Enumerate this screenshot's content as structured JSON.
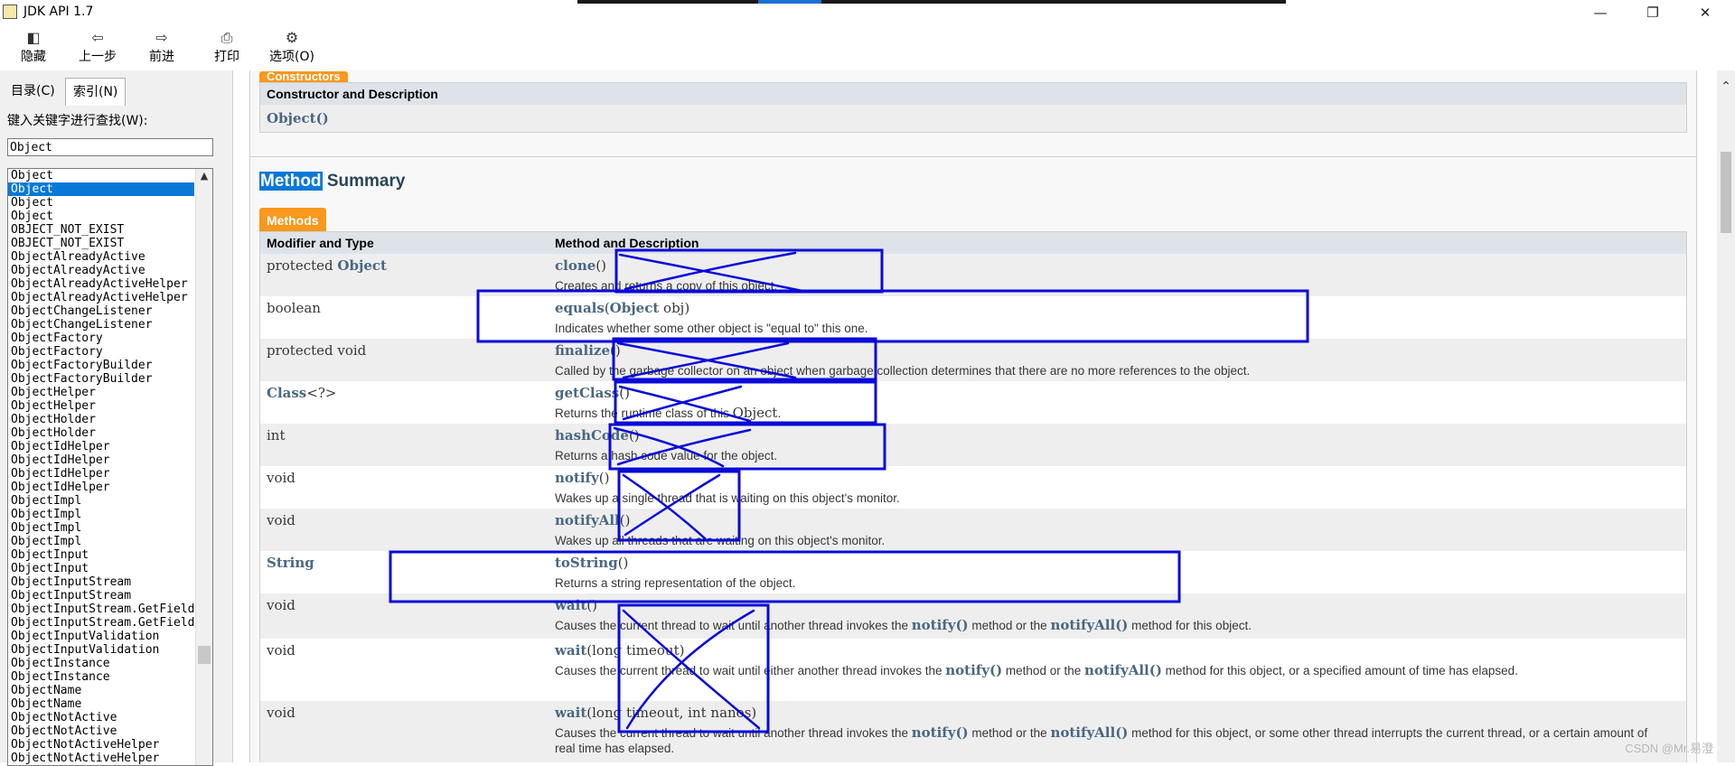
{
  "window": {
    "title": "JDK API 1.7",
    "min": "—",
    "max": "❐",
    "close": "✕"
  },
  "toolbar": [
    {
      "label": "隐藏",
      "icon": "hide-icon",
      "glyph": "◧"
    },
    {
      "label": "上一步",
      "icon": "back-arrow-icon",
      "glyph": "⇦"
    },
    {
      "label": "前进",
      "icon": "forward-arrow-icon",
      "glyph": "⇨"
    },
    {
      "label": "打印",
      "icon": "printer-icon",
      "glyph": "⎙"
    },
    {
      "label": "选项(O)",
      "icon": "options-icon",
      "glyph": "⚙"
    }
  ],
  "sidebar": {
    "tabs": [
      {
        "label": "目录(C)"
      },
      {
        "label": "索引(N)"
      }
    ],
    "search_label": "键入关键字进行查找(W):",
    "search_value": "Object",
    "selected_index": 1,
    "items": [
      "Object",
      "Object",
      "Object",
      "Object",
      "OBJECT_NOT_EXIST",
      "OBJECT_NOT_EXIST",
      "ObjectAlreadyActive",
      "ObjectAlreadyActive",
      "ObjectAlreadyActiveHelper",
      "ObjectAlreadyActiveHelper",
      "ObjectChangeListener",
      "ObjectChangeListener",
      "ObjectFactory",
      "ObjectFactory",
      "ObjectFactoryBuilder",
      "ObjectFactoryBuilder",
      "ObjectHelper",
      "ObjectHelper",
      "ObjectHolder",
      "ObjectHolder",
      "ObjectIdHelper",
      "ObjectIdHelper",
      "ObjectIdHelper",
      "ObjectIdHelper",
      "ObjectImpl",
      "ObjectImpl",
      "ObjectImpl",
      "ObjectImpl",
      "ObjectInput",
      "ObjectInput",
      "ObjectInputStream",
      "ObjectInputStream",
      "ObjectInputStream.GetField",
      "ObjectInputStream.GetField",
      "ObjectInputValidation",
      "ObjectInputValidation",
      "ObjectInstance",
      "ObjectInstance",
      "ObjectName",
      "ObjectName",
      "ObjectNotActive",
      "ObjectNotActive",
      "ObjectNotActiveHelper",
      "ObjectNotActiveHelper"
    ]
  },
  "constructors": {
    "caption": "Constructors",
    "header": "Constructor and Description",
    "row": "Object()"
  },
  "method_summary": {
    "title_hl": "Method",
    "title_rest": " Summary",
    "caption": "Methods",
    "col_type": "Modifier and Type",
    "col_desc": "Method and Description",
    "rows": [
      {
        "type_pre": "protected ",
        "type_link": "Object",
        "name": "clone",
        "params": "()",
        "desc": "Creates and returns a copy of this object."
      },
      {
        "type_pre": "boolean",
        "type_link": "",
        "name": "equals",
        "params_link": "Object",
        "params": " obj)",
        "params_open": "(",
        "desc": "Indicates whether some other object is \"equal to\" this one."
      },
      {
        "type_pre": "protected void",
        "type_link": "",
        "name": "finalize",
        "params": "()",
        "desc": "Called by the garbage collector on an object when garbage collection determines that there are no more references to the object."
      },
      {
        "type_pre": "",
        "type_link": "Class",
        "type_post": "<?>",
        "name": "getClass",
        "params": "()",
        "desc": "Returns the runtime class of this ",
        "desc_code": "Object",
        "desc_tail": "."
      },
      {
        "type_pre": "int",
        "type_link": "",
        "name": "hashCode",
        "params": "()",
        "desc": "Returns a hash code value for the object."
      },
      {
        "type_pre": "void",
        "type_link": "",
        "name": "notify",
        "params": "()",
        "desc": "Wakes up a single thread that is waiting on this object's monitor."
      },
      {
        "type_pre": "void",
        "type_link": "",
        "name": "notifyAll",
        "params": "()",
        "desc": "Wakes up all threads that are waiting on this object's monitor."
      },
      {
        "type_pre": "",
        "type_link": "String",
        "name": "toString",
        "params": "()",
        "desc": "Returns a string representation of the object."
      },
      {
        "type_pre": "void",
        "type_link": "",
        "name": "wait",
        "params": "()",
        "d1": "Causes the current thread to wait until another thread invokes the ",
        "c1": "notify()",
        "d2": " method or the ",
        "c2": "notifyAll()",
        "d3": " method for this object."
      },
      {
        "type_pre": "void",
        "type_link": "",
        "name": "wait",
        "params": "(long timeout)",
        "d1": "Causes the current thread to wait until either another thread invokes the ",
        "c1": "notify()",
        "d2": " method or the ",
        "c2": "notifyAll()",
        "d3": " method for this object, or a specified amount of time has elapsed."
      },
      {
        "type_pre": "void",
        "type_link": "",
        "name": "wait",
        "params": "(long timeout, int nanos)",
        "d1": "Causes the current thread to wait until another thread invokes the ",
        "c1": "notify()",
        "d2": " method or the ",
        "c2": "notifyAll()",
        "d3": " method for this object, or some other thread interrupts the current thread, or a certain amount of real time has elapsed."
      }
    ]
  },
  "annotation_color": "#0a0ad8",
  "watermark": "CSDN @Mr.易澄"
}
